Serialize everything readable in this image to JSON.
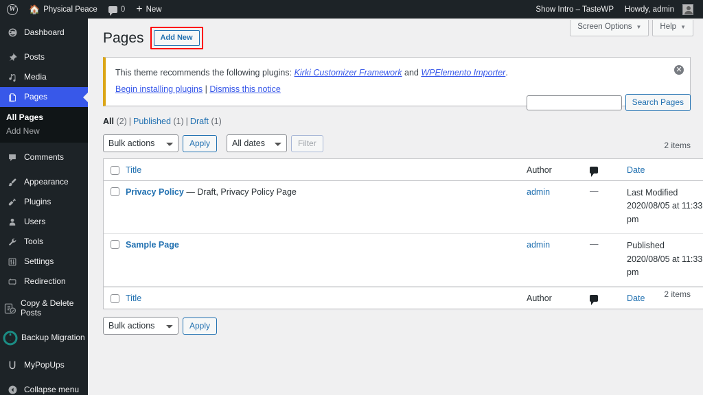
{
  "adminbar": {
    "wp_logo": "wordpress-logo",
    "site_name": "Physical Peace",
    "comment_count": "0",
    "new_label": "New",
    "show_intro": "Show Intro – TasteWP",
    "howdy": "Howdy, admin"
  },
  "sidebar": {
    "items": [
      {
        "label": "Dashboard",
        "icon": "dashboard-icon",
        "current": false
      },
      {
        "label": "Posts",
        "icon": "pin-icon",
        "current": false
      },
      {
        "label": "Media",
        "icon": "media-icon",
        "current": false
      },
      {
        "label": "Pages",
        "icon": "pages-icon",
        "current": true
      },
      {
        "label": "Comments",
        "icon": "comments-icon",
        "current": false
      },
      {
        "label": "Appearance",
        "icon": "brush-icon",
        "current": false
      },
      {
        "label": "Plugins",
        "icon": "plugins-icon",
        "current": false
      },
      {
        "label": "Users",
        "icon": "users-icon",
        "current": false
      },
      {
        "label": "Tools",
        "icon": "wrench-icon",
        "current": false
      },
      {
        "label": "Settings",
        "icon": "settings-icon",
        "current": false
      },
      {
        "label": "Redirection",
        "icon": "redirection-icon",
        "current": false
      },
      {
        "label": "Copy & Delete Posts",
        "icon": "copy-delete-posts-icon",
        "current": false
      },
      {
        "label": "Backup Migration",
        "icon": "backup-migration-icon",
        "current": false
      },
      {
        "label": "MyPopUps",
        "icon": "mypopups-icon",
        "current": false
      },
      {
        "label": "Collapse menu",
        "icon": "collapse-icon",
        "current": false
      }
    ],
    "submenu": {
      "all_pages": "All Pages",
      "add_new": "Add New"
    }
  },
  "screen_meta": {
    "screen_options": "Screen Options",
    "help": "Help",
    "caret": "▼"
  },
  "header": {
    "title": "Pages",
    "add_new": "Add New",
    "add_new_highlighted": true,
    "highlight_color": "#ff0000"
  },
  "notice": {
    "text_before": "This theme recommends the following plugins:",
    "plugin1": "Kirki Customizer Framework",
    "conjunction": "and",
    "plugin2": "WPElemento Importer",
    "period": ".",
    "action_install": "Begin installing plugins",
    "divider": "|",
    "action_dismiss": "Dismiss this notice",
    "dismiss_icon": "close-icon",
    "border_color": "#dba617"
  },
  "filters": {
    "all_label": "All",
    "all_count": "(2)",
    "published_label": "Published",
    "published_count": "(1)",
    "draft_label": "Draft",
    "draft_count": "(1)",
    "divider": "|"
  },
  "search": {
    "value": "",
    "placeholder": "",
    "button": "Search Pages"
  },
  "tablenav_top": {
    "bulk_actions": "Bulk actions",
    "apply": "Apply",
    "all_dates": "All dates",
    "filter": "Filter",
    "items": "2 items"
  },
  "tablenav_bottom": {
    "bulk_actions": "Bulk actions",
    "apply": "Apply",
    "items": "2 items"
  },
  "table": {
    "columns": {
      "title": "Title",
      "author": "Author",
      "comments": "comments-icon",
      "date": "Date"
    },
    "rows": [
      {
        "title": "Privacy Policy",
        "state": "— Draft, Privacy Policy Page",
        "author": "admin",
        "comments": "—",
        "date_status": "Last Modified",
        "date_value": "2020/08/05 at 11:33 pm"
      },
      {
        "title": "Sample Page",
        "state": "",
        "author": "admin",
        "comments": "—",
        "date_status": "Published",
        "date_value": "2020/08/05 at 11:33 pm"
      }
    ]
  },
  "colors": {
    "admin_bar": "#1d2327",
    "sidebar": "#1d2327",
    "current_menu": "#3858e9",
    "link": "#2271b1",
    "notice_accent": "#dba617",
    "page_bg": "#f0f0f1"
  }
}
